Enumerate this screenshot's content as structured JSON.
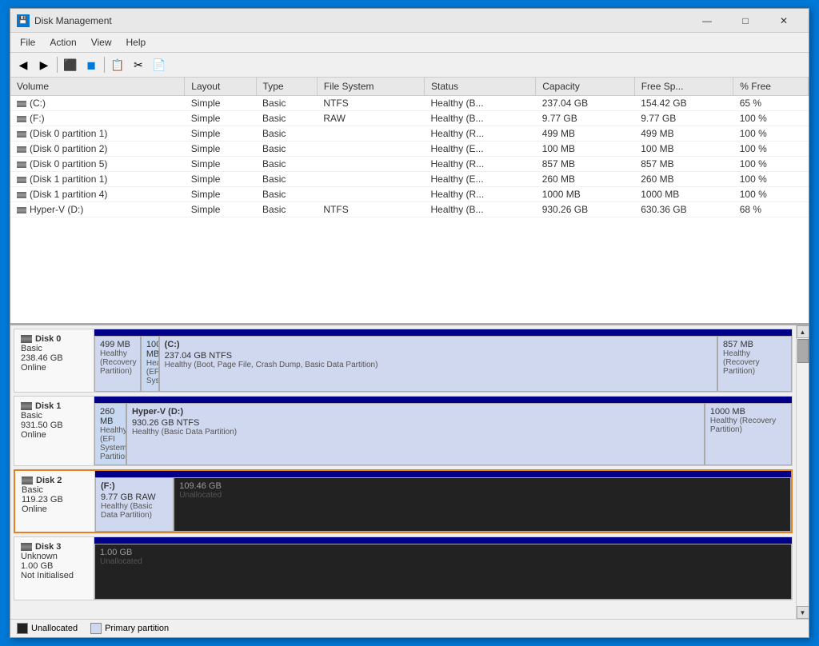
{
  "window": {
    "title": "Disk Management",
    "controls": {
      "minimize": "—",
      "maximize": "□",
      "close": "✕"
    }
  },
  "menu": {
    "items": [
      "File",
      "Action",
      "View",
      "Help"
    ]
  },
  "toolbar": {
    "buttons": [
      "◀",
      "▶",
      "⬛",
      "🔵",
      "📋",
      "✂",
      "📄"
    ]
  },
  "table": {
    "columns": [
      "Volume",
      "Layout",
      "Type",
      "File System",
      "Status",
      "Capacity",
      "Free Sp...",
      "% Free"
    ],
    "rows": [
      {
        "volume": "(C:)",
        "layout": "Simple",
        "type": "Basic",
        "fs": "NTFS",
        "status": "Healthy (B...",
        "capacity": "237.04 GB",
        "free": "154.42 GB",
        "pct": "65 %"
      },
      {
        "volume": "(F:)",
        "layout": "Simple",
        "type": "Basic",
        "fs": "RAW",
        "status": "Healthy (B...",
        "capacity": "9.77 GB",
        "free": "9.77 GB",
        "pct": "100 %"
      },
      {
        "volume": "(Disk 0 partition 1)",
        "layout": "Simple",
        "type": "Basic",
        "fs": "",
        "status": "Healthy (R...",
        "capacity": "499 MB",
        "free": "499 MB",
        "pct": "100 %"
      },
      {
        "volume": "(Disk 0 partition 2)",
        "layout": "Simple",
        "type": "Basic",
        "fs": "",
        "status": "Healthy (E...",
        "capacity": "100 MB",
        "free": "100 MB",
        "pct": "100 %"
      },
      {
        "volume": "(Disk 0 partition 5)",
        "layout": "Simple",
        "type": "Basic",
        "fs": "",
        "status": "Healthy (R...",
        "capacity": "857 MB",
        "free": "857 MB",
        "pct": "100 %"
      },
      {
        "volume": "(Disk 1 partition 1)",
        "layout": "Simple",
        "type": "Basic",
        "fs": "",
        "status": "Healthy (E...",
        "capacity": "260 MB",
        "free": "260 MB",
        "pct": "100 %"
      },
      {
        "volume": "(Disk 1 partition 4)",
        "layout": "Simple",
        "type": "Basic",
        "fs": "",
        "status": "Healthy (R...",
        "capacity": "1000 MB",
        "free": "1000 MB",
        "pct": "100 %"
      },
      {
        "volume": "Hyper-V (D:)",
        "layout": "Simple",
        "type": "Basic",
        "fs": "NTFS",
        "status": "Healthy (B...",
        "capacity": "930.26 GB",
        "free": "630.36 GB",
        "pct": "68 %"
      }
    ]
  },
  "disks": [
    {
      "id": "disk0",
      "name": "Disk 0",
      "type": "Basic",
      "size": "238.46 GB",
      "status": "Online",
      "selected": false,
      "partitions": [
        {
          "label": "",
          "size": "499 MB",
          "desc": "Healthy (Recovery Partition)",
          "type": "primary",
          "flex": 5
        },
        {
          "label": "",
          "size": "100 MB",
          "desc": "Healthy (EFI System",
          "type": "system",
          "flex": 1
        },
        {
          "label": "(C:)",
          "size": "237.04 GB NTFS",
          "desc": "Healthy (Boot, Page File, Crash Dump, Basic Data Partition)",
          "type": "primary",
          "flex": 78
        },
        {
          "label": "",
          "size": "857 MB",
          "desc": "Healthy (Recovery Partition)",
          "type": "primary",
          "flex": 9
        }
      ]
    },
    {
      "id": "disk1",
      "name": "Disk 1",
      "type": "Basic",
      "size": "931.50 GB",
      "status": "Online",
      "selected": false,
      "partitions": [
        {
          "label": "",
          "size": "260 MB",
          "desc": "Healthy (EFI System Partition)",
          "type": "system",
          "flex": 3
        },
        {
          "label": "Hyper-V (D:)",
          "size": "930.26 GB NTFS",
          "desc": "Healthy (Basic Data Partition)",
          "type": "primary",
          "flex": 82
        },
        {
          "label": "",
          "size": "1000 MB",
          "desc": "Healthy (Recovery Partition)",
          "type": "primary",
          "flex": 11
        }
      ]
    },
    {
      "id": "disk2",
      "name": "Disk 2",
      "type": "Basic",
      "size": "119.23 GB",
      "status": "Online",
      "selected": true,
      "partitions": [
        {
          "label": "(F:)",
          "size": "9.77 GB RAW",
          "desc": "Healthy (Basic Data Partition)",
          "type": "primary",
          "flex": 10
        },
        {
          "label": "",
          "size": "109.46 GB",
          "desc": "Unallocated",
          "type": "unallocated",
          "flex": 90
        }
      ]
    },
    {
      "id": "disk3",
      "name": "Disk 3",
      "type": "Unknown",
      "size": "1.00 GB",
      "status": "Not Initialised",
      "selected": false,
      "partitions": [
        {
          "label": "",
          "size": "1.00 GB",
          "desc": "Unallocated",
          "type": "unallocated",
          "flex": 100
        }
      ]
    }
  ],
  "legend": [
    {
      "label": "Unallocated",
      "color": "#222"
    },
    {
      "label": "Primary partition",
      "color": "#d0d8f0"
    }
  ]
}
